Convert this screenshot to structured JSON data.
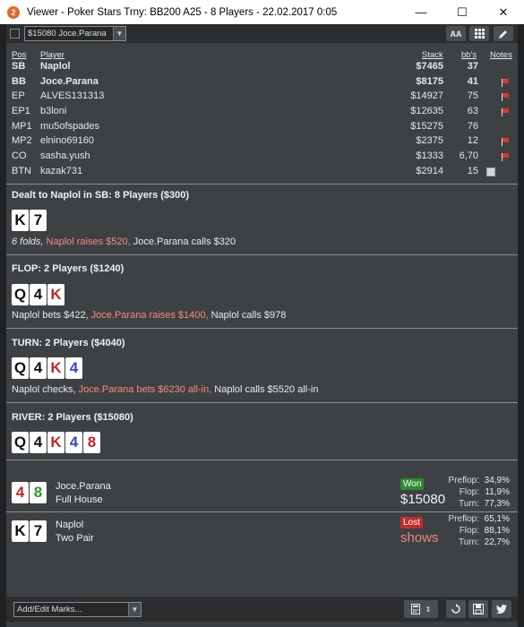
{
  "window": {
    "title": "Viewer - Poker Stars Trny: BB200 A25 - 8 Players - 22.02.2017 0:05",
    "app_icon": "2",
    "minimize": "—",
    "maximize": "☐",
    "close": "✕"
  },
  "toolbar": {
    "hand_select_value": "$15080 Joce.Parana",
    "font_size_label": "AA",
    "grid_icon": "grid-icon",
    "edit_icon": "pencil-icon"
  },
  "table": {
    "headers": {
      "pos": "Pos",
      "player": "Player",
      "stack": "Stack",
      "bbs": "bb's",
      "notes": "Notes"
    },
    "rows": [
      {
        "pos": "SB",
        "player": "Naplol",
        "stack": "$7465",
        "bbs": "37",
        "hero": true,
        "note": ""
      },
      {
        "pos": "BB",
        "player": "Joce.Parana",
        "stack": "$8175",
        "bbs": "41",
        "hero": true,
        "note": "flag"
      },
      {
        "pos": "EP",
        "player": "ALVES131313",
        "stack": "$14927",
        "bbs": "75",
        "hero": false,
        "note": "flag"
      },
      {
        "pos": "EP1",
        "player": "b3loni",
        "stack": "$12635",
        "bbs": "63",
        "hero": false,
        "note": "flag"
      },
      {
        "pos": "MP1",
        "player": "mu5ofspades",
        "stack": "$15275",
        "bbs": "76",
        "hero": false,
        "note": ""
      },
      {
        "pos": "MP2",
        "player": "elnino69160",
        "stack": "$2375",
        "bbs": "12",
        "hero": false,
        "note": "flag"
      },
      {
        "pos": "CO",
        "player": "sasha.yush",
        "stack": "$1333",
        "bbs": "6,70",
        "hero": false,
        "note": "flag"
      },
      {
        "pos": "BTN",
        "player": "kazak731",
        "stack": "$2914",
        "bbs": "15",
        "hero": false,
        "note": "image"
      }
    ]
  },
  "streets": {
    "preflop": {
      "title": "Dealt to Naplol in SB: 8 Players ($300)",
      "cards": [
        {
          "rank": "K",
          "color": "black"
        },
        {
          "rank": "7",
          "color": "black"
        }
      ],
      "action_1": "6 folds,",
      "action_2": " Naplol raises $520,",
      "action_3": " Joce.Parana calls $320"
    },
    "flop": {
      "title": "FLOP: 2 Players ($1240)",
      "cards": [
        {
          "rank": "Q",
          "color": "black"
        },
        {
          "rank": "4",
          "color": "black"
        },
        {
          "rank": "K",
          "color": "red"
        }
      ],
      "action_1": "Naplol bets $422,",
      "action_2": " Joce.Parana raises $1400,",
      "action_3": " Naplol calls $978"
    },
    "turn": {
      "title": "TURN: 2 Players ($4040)",
      "cards": [
        {
          "rank": "Q",
          "color": "black"
        },
        {
          "rank": "4",
          "color": "black"
        },
        {
          "rank": "K",
          "color": "red"
        },
        {
          "rank": "4",
          "color": "blue"
        }
      ],
      "action_1": "Naplol checks,",
      "action_2": " Joce.Parana bets $6230 all-in,",
      "action_3": " Naplol calls $5520 all-in"
    },
    "river": {
      "title": "RIVER: 2 Players ($15080)",
      "cards": [
        {
          "rank": "Q",
          "color": "black"
        },
        {
          "rank": "4",
          "color": "black"
        },
        {
          "rank": "K",
          "color": "red"
        },
        {
          "rank": "4",
          "color": "blue"
        },
        {
          "rank": "8",
          "color": "red"
        }
      ]
    }
  },
  "results": [
    {
      "player": "Joce.Parana",
      "hand": "Full House",
      "badge": "Won",
      "amount": "$15080",
      "cards": [
        {
          "rank": "4",
          "color": "red"
        },
        {
          "rank": "8",
          "color": "green"
        }
      ],
      "stats": [
        {
          "label": "Preflop:",
          "value": "34,9%"
        },
        {
          "label": "Flop:",
          "value": "11,9%"
        },
        {
          "label": "Turn:",
          "value": "77,3%"
        }
      ]
    },
    {
      "player": "Naplol",
      "hand": "Two Pair",
      "badge": "Lost",
      "amount": "shows",
      "cards": [
        {
          "rank": "K",
          "color": "black"
        },
        {
          "rank": "7",
          "color": "black"
        }
      ],
      "stats": [
        {
          "label": "Preflop:",
          "value": "65,1%"
        },
        {
          "label": "Flop:",
          "value": "88,1%"
        },
        {
          "label": "Turn:",
          "value": "22,7%"
        }
      ]
    }
  ],
  "bottom": {
    "marks_placeholder": "Add/Edit Marks...",
    "calculator_icon": "calculator-icon",
    "replay_icon": "replay-icon",
    "save_icon": "save-icon",
    "twitter_icon": "twitter-icon"
  },
  "colors": {
    "panel_bg": "#3e4144",
    "accent_red": "#f08d7a",
    "won_green": "#2d8a2d",
    "lost_red": "#c42b2b"
  }
}
